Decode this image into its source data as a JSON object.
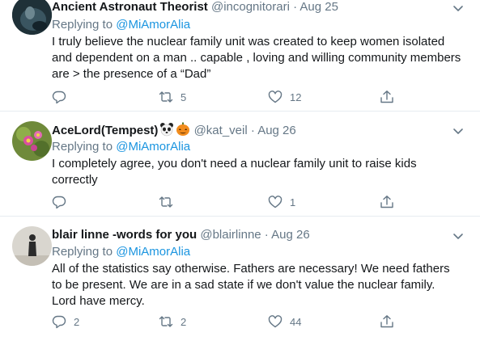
{
  "tweets": [
    {
      "display_name": "Ancient Astronaut Theorist",
      "handle": "@incognitorari",
      "date": "Aug 25",
      "replying_prefix": "Replying to",
      "replying_to": "@MiAmorAlia",
      "body": "I truly believe the nuclear family unit was created to keep women isolated and dependent on a man .. capable , loving and willing community members are > the presence of a “Dad”",
      "reply_count": "",
      "retweet_count": "5",
      "like_count": "12"
    },
    {
      "display_name": "AceLord(Tempest)",
      "handle": "@kat_veil",
      "date": "Aug 26",
      "replying_prefix": "Replying to",
      "replying_to": "@MiAmorAlia",
      "body": "I completely agree, you don't need a nuclear family unit to raise kids correctly",
      "reply_count": "",
      "retweet_count": "",
      "like_count": "1"
    },
    {
      "display_name": "blair linne -words for you",
      "handle": "@blairlinne",
      "date": "Aug 26",
      "replying_prefix": "Replying to",
      "replying_to": "@MiAmorAlia",
      "body": "All of the statistics say otherwise. Fathers are necessary! We need fathers to be present. We are in a sad state if we don't value the nuclear family. Lord have mercy.",
      "reply_count": "2",
      "retweet_count": "2",
      "like_count": "44"
    }
  ],
  "separator": "·",
  "colors": {
    "name": "#14171a",
    "meta": "#657786",
    "link": "#1b95e0",
    "divider": "#e6ecf0"
  }
}
